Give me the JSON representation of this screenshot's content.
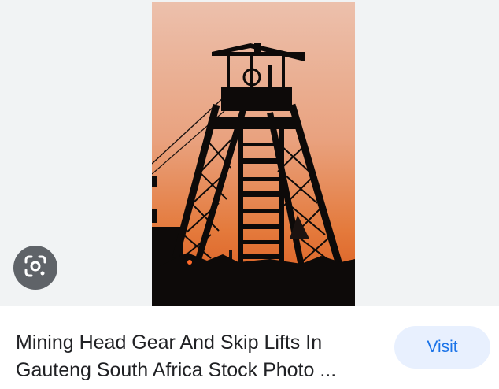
{
  "result": {
    "title_line1": "Mining Head Gear And Skip Lifts In",
    "title_line2": "Gauteng South Africa Stock Photo ...",
    "visit_label": "Visit",
    "image_alt": "Mining head gear silhouette at sunset",
    "lens_icon": "google-lens-icon"
  },
  "colors": {
    "panel_bg": "#f1f3f4",
    "lens_bg": "#5f6368",
    "visit_bg": "#e8f0fe",
    "visit_text": "#1a73e8",
    "title_text": "#202124",
    "sky_top": "#e9b59a",
    "sky_bottom": "#e06a22"
  }
}
